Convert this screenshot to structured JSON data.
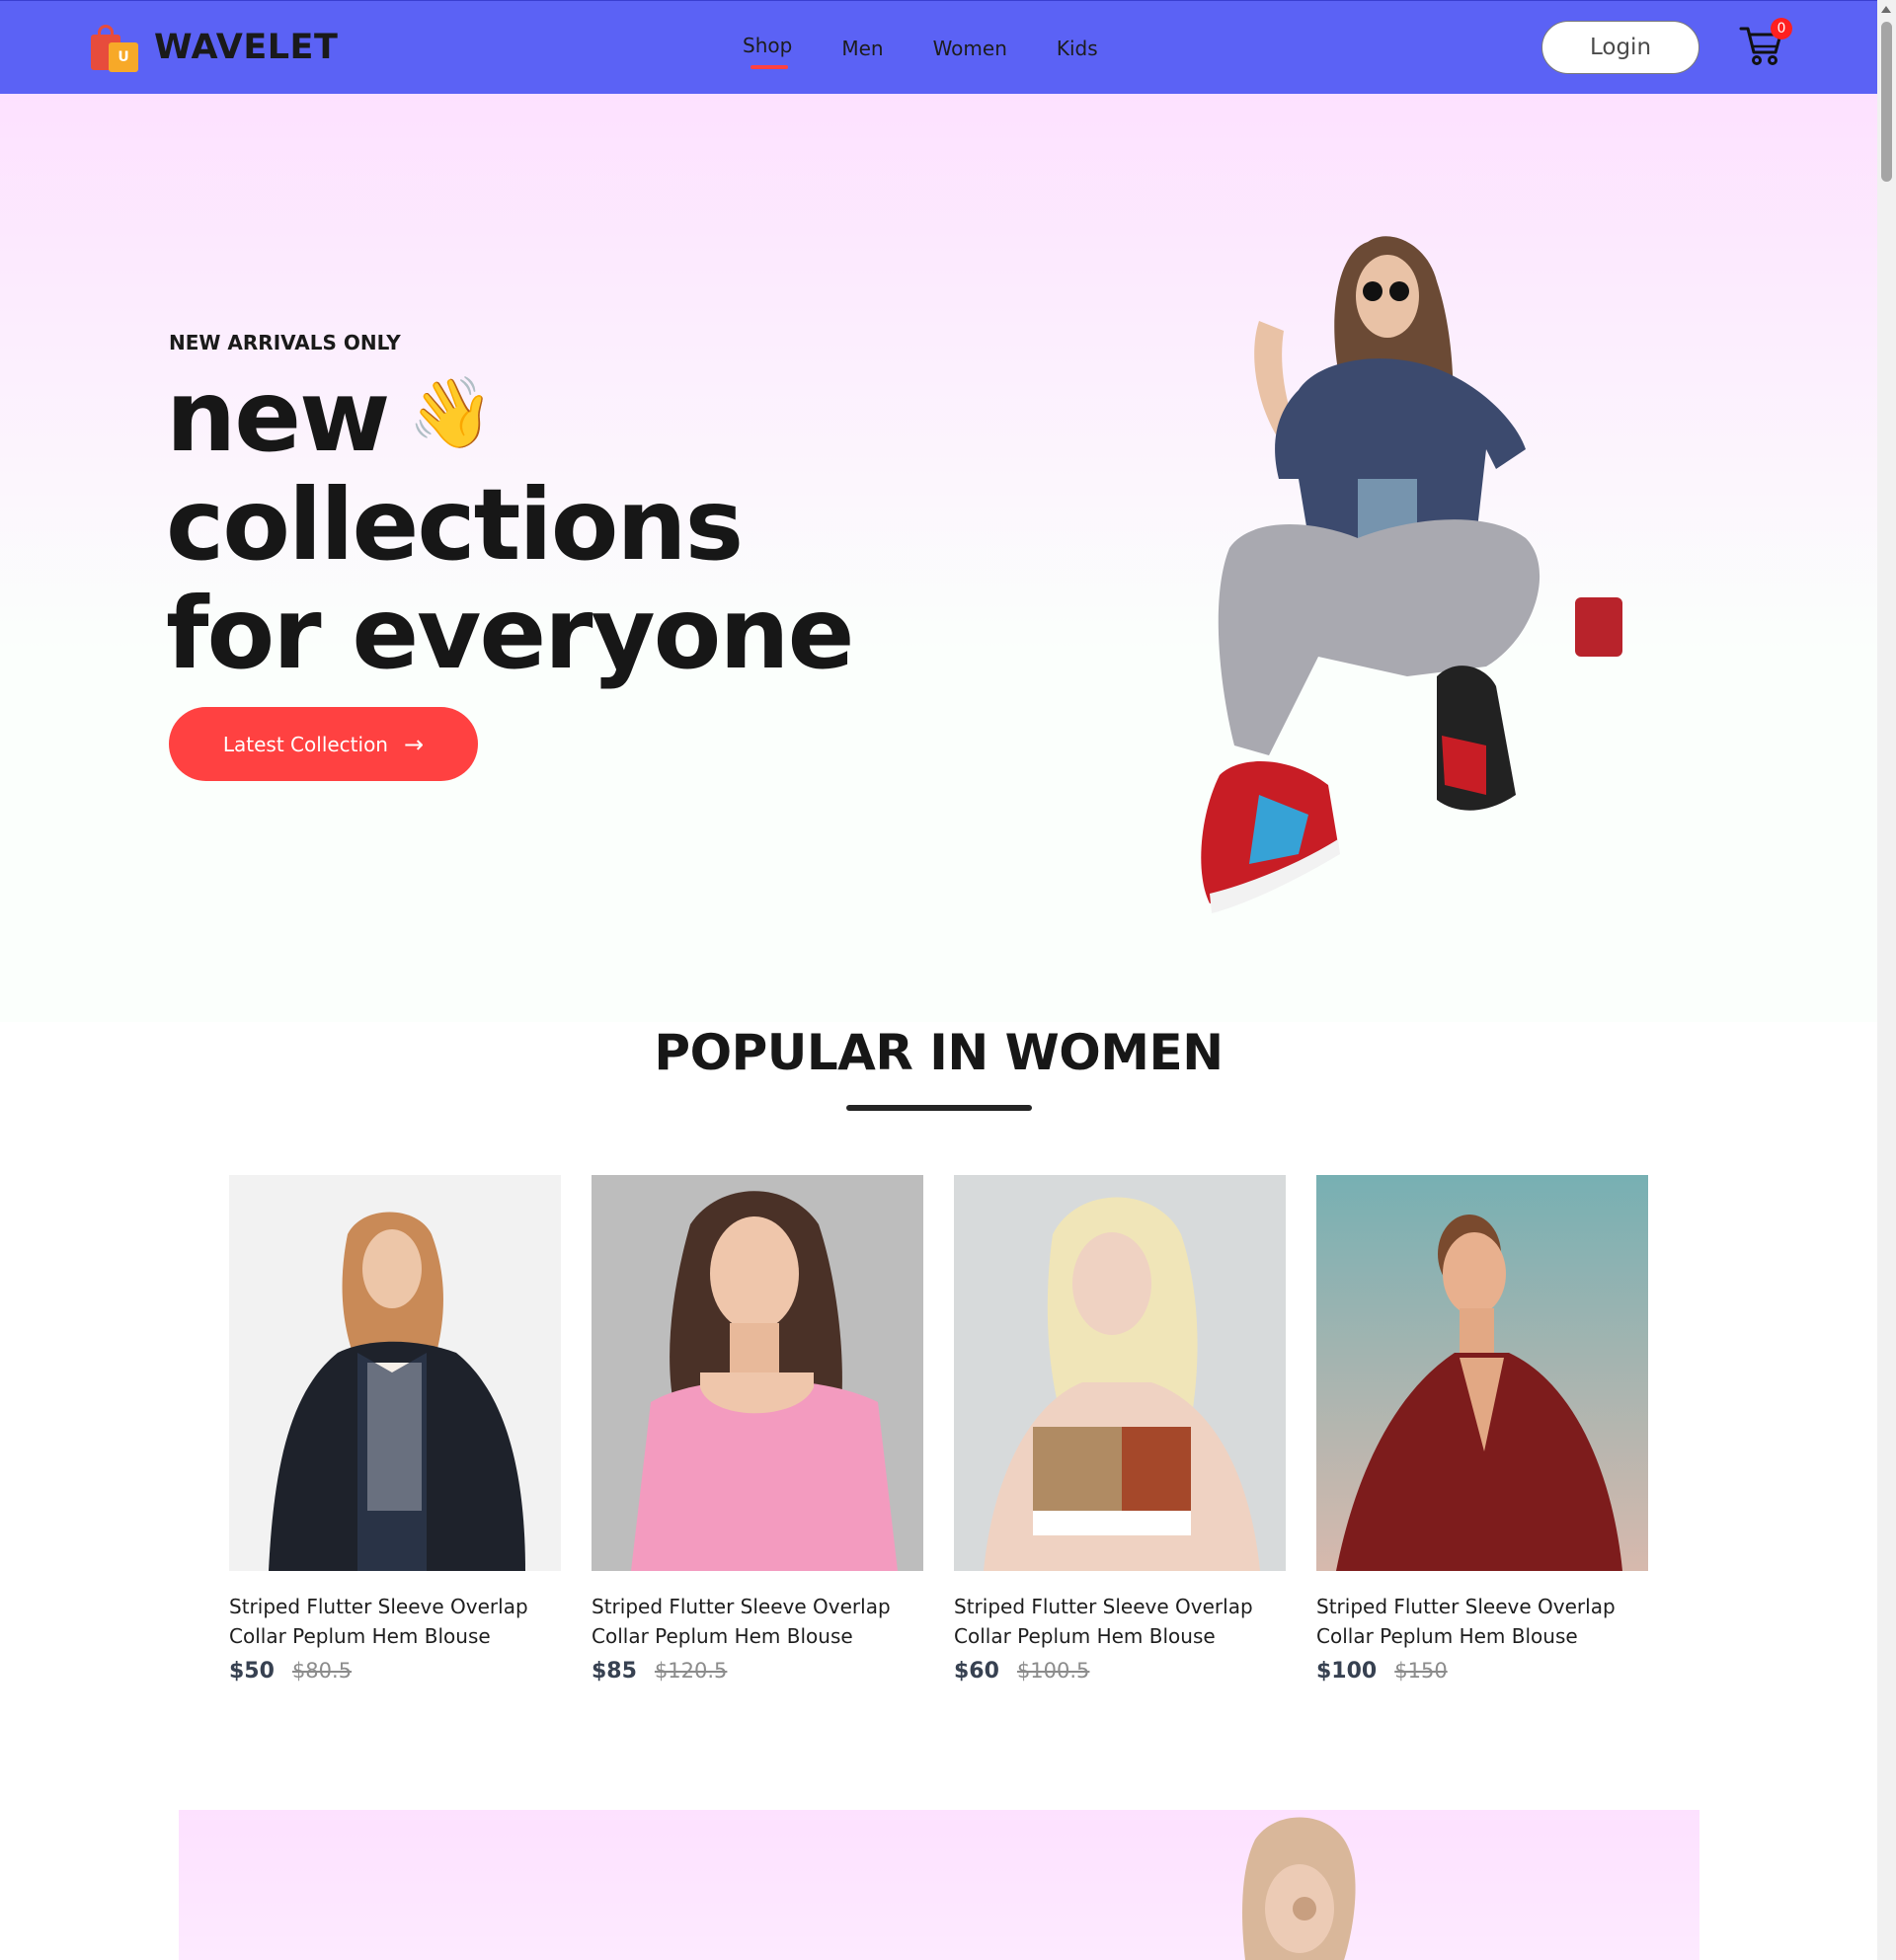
{
  "nav": {
    "brand": "WAVELET",
    "logo_letter": "U",
    "links": [
      "Shop",
      "Men",
      "Women",
      "Kids"
    ],
    "active_link": "Shop",
    "login_label": "Login",
    "cart_count": "0"
  },
  "hero": {
    "eyebrow": "NEW ARRIVALS ONLY",
    "title_lines": [
      "new",
      "collections",
      "for everyone"
    ],
    "wave_emoji": "👋",
    "button_label": "Latest Collection",
    "button_arrow": "→"
  },
  "popular": {
    "title": "POPULAR IN WOMEN",
    "products": [
      {
        "name": "Striped Flutter Sleeve Overlap Collar Peplum Hem Blouse",
        "new_price": "$50",
        "old_price": "$80.5"
      },
      {
        "name": "Striped Flutter Sleeve Overlap Collar Peplum Hem Blouse",
        "new_price": "$85",
        "old_price": "$120.5"
      },
      {
        "name": "Striped Flutter Sleeve Overlap Collar Peplum Hem Blouse",
        "new_price": "$60",
        "old_price": "$100.5"
      },
      {
        "name": "Striped Flutter Sleeve Overlap Collar Peplum Hem Blouse",
        "new_price": "$100",
        "old_price": "$150"
      }
    ]
  },
  "colors": {
    "navbar": "#5b62f5",
    "accent_red": "#ff4141",
    "hero_gradient_top": "#fde1ff"
  },
  "icons": [
    "shopping-bags-logo-icon",
    "cart-icon",
    "arrow-right-icon",
    "waving-hand-icon"
  ]
}
